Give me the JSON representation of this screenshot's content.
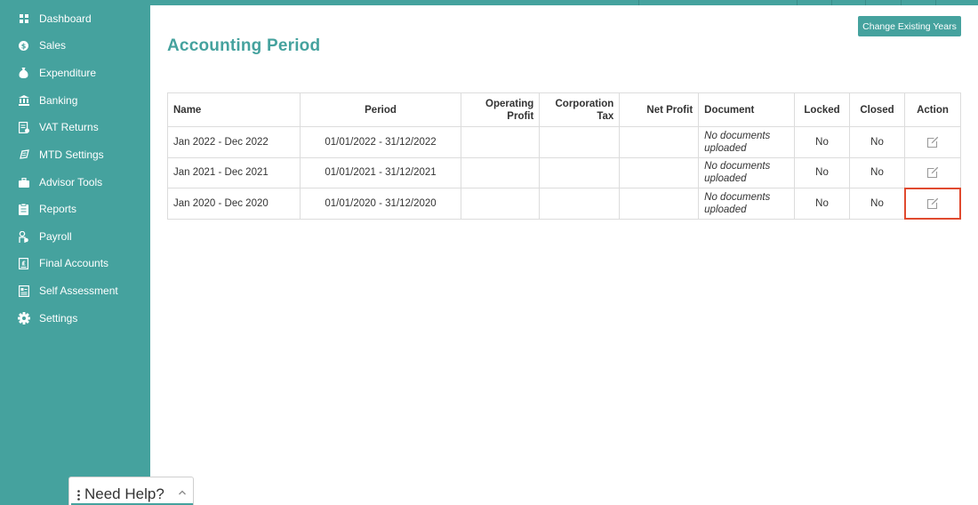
{
  "sidebar": {
    "items": [
      {
        "label": "Dashboard",
        "icon": "dashboard-icon"
      },
      {
        "label": "Sales",
        "icon": "sales-icon"
      },
      {
        "label": "Expenditure",
        "icon": "money-bag-icon"
      },
      {
        "label": "Banking",
        "icon": "bank-icon"
      },
      {
        "label": "VAT Returns",
        "icon": "vat-icon"
      },
      {
        "label": "MTD Settings",
        "icon": "mtd-icon"
      },
      {
        "label": "Advisor Tools",
        "icon": "briefcase-icon"
      },
      {
        "label": "Reports",
        "icon": "reports-icon"
      },
      {
        "label": "Payroll",
        "icon": "payroll-icon"
      },
      {
        "label": "Final Accounts",
        "icon": "final-accounts-icon"
      },
      {
        "label": "Self Assessment",
        "icon": "self-assessment-icon"
      },
      {
        "label": "Settings",
        "icon": "gear-icon"
      }
    ]
  },
  "main": {
    "title": "Accounting Period",
    "change_button": "Change Existing Years"
  },
  "table": {
    "headers": {
      "name": "Name",
      "period": "Period",
      "operating_profit": "Operating Profit",
      "corporation_tax": "Corporation Tax",
      "net_profit": "Net Profit",
      "document": "Document",
      "locked": "Locked",
      "closed": "Closed",
      "action": "Action"
    },
    "rows": [
      {
        "name": "Jan 2022 - Dec 2022",
        "period": "01/01/2022 - 31/12/2022",
        "operating_profit": "",
        "corporation_tax": "",
        "net_profit": "",
        "document": "No documents uploaded",
        "locked": "No",
        "closed": "No",
        "action_icon": "edit-icon"
      },
      {
        "name": "Jan 2021 - Dec 2021",
        "period": "01/01/2021 - 31/12/2021",
        "operating_profit": "",
        "corporation_tax": "",
        "net_profit": "",
        "document": "No documents uploaded",
        "locked": "No",
        "closed": "No",
        "action_icon": "edit-icon"
      },
      {
        "name": "Jan 2020 - Dec 2020",
        "period": "01/01/2020 - 31/12/2020",
        "operating_profit": "",
        "corporation_tax": "",
        "net_profit": "",
        "document": "No documents uploaded",
        "locked": "No",
        "closed": "No",
        "action_icon": "edit-icon"
      }
    ]
  },
  "help_widget": {
    "label": "Need Help?"
  },
  "colors": {
    "brand": "#45a29e",
    "highlight": "#e04a2f"
  }
}
